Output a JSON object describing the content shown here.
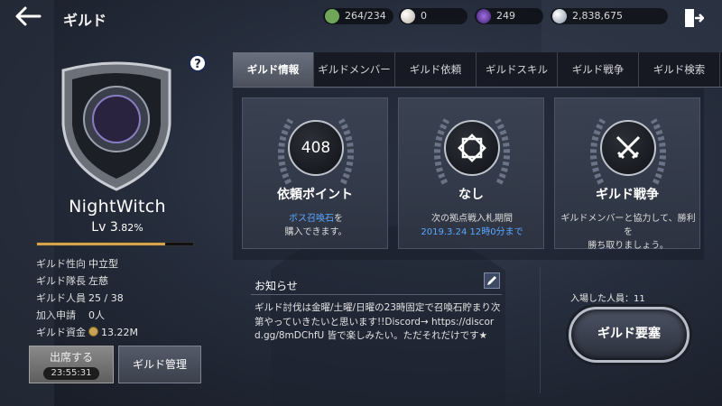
{
  "header": {
    "title": "ギルド",
    "back_icon": "back-arrow-icon",
    "exit_icon": "exit-door-icon",
    "resources": [
      {
        "name": "stamina",
        "icon": "stamina-icon",
        "value": "264/234",
        "color": "#6fa65a"
      },
      {
        "name": "pearl",
        "icon": "pearl-icon",
        "value": "0",
        "color": "#d9d0c8"
      },
      {
        "name": "dark-gem",
        "icon": "dark-gem-icon",
        "value": "249",
        "color": "#6a3fa8"
      },
      {
        "name": "silver",
        "icon": "silver-coin-icon",
        "value": "2,838,675",
        "color": "#c9d3e0"
      }
    ]
  },
  "guild": {
    "name": "NightWitch",
    "level_label": "Lv 3",
    "level_percent_label": ".82%",
    "xp_fraction": 0.82,
    "info": [
      {
        "key": "ギルド性向",
        "value": "中立型"
      },
      {
        "key": "ギルド隊長",
        "value": "左慈"
      },
      {
        "key": "ギルド人員",
        "value": "25 / 38"
      },
      {
        "key": "加入申請",
        "value": "0人"
      },
      {
        "key": "ギルド資金",
        "value": "13.22M"
      }
    ]
  },
  "buttons": {
    "attend": "出席する",
    "attend_timer": "23:55:31",
    "manage": "ギルド管理",
    "help": "?"
  },
  "tabs": [
    {
      "label": "ギルド情報",
      "active": true
    },
    {
      "label": "ギルドメンバー",
      "active": false
    },
    {
      "label": "ギルド依頼",
      "active": false
    },
    {
      "label": "ギルドスキル",
      "active": false
    },
    {
      "label": "ギルド戦争",
      "active": false
    },
    {
      "label": "ギルド検索",
      "active": false
    }
  ],
  "cards": [
    {
      "icon": "quest-points-badge",
      "badge": "408",
      "title": "依頼ポイント",
      "desc_line1_highlight": "ボス召喚石",
      "desc_line1_rest": "を",
      "desc_line2": "購入できます。"
    },
    {
      "icon": "stronghold-emblem-icon",
      "title": "なし",
      "desc_line1": "次の拠点戦入札期間",
      "desc_line2_highlight": "2019.3.24 12時0分まで"
    },
    {
      "icon": "crossed-swords-icon",
      "title": "ギルド戦争",
      "desc_line1": "ギルドメンバーと協力して、勝利を",
      "desc_line2": "勝ち取りましょう。"
    }
  ],
  "notice": {
    "title": "お知らせ",
    "text": "ギルド討伐は金曜/土曜/日曜の23時固定で召喚石貯まり次第やっていきたいと思います!!Discord→ https://discord.gg/8mDChfU 皆で楽しみたい。ただそれだけです★"
  },
  "fortress": {
    "entered_label": "入場した人員：11",
    "button": "ギルド要塞"
  },
  "colors": {
    "accent_blue": "#59a8ff",
    "xp_fill": "#d4a34a"
  }
}
